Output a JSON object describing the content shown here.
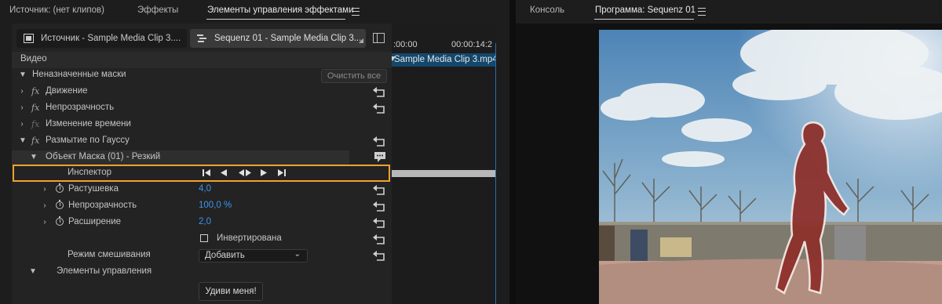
{
  "left_tabs": [
    {
      "label": "Источник: (нет клипов)",
      "active": false
    },
    {
      "label": "Эффекты",
      "active": false
    },
    {
      "label": "Элементы управления эффектами",
      "active": true
    }
  ],
  "right_tabs": [
    {
      "label": "Консоль",
      "active": false
    },
    {
      "label": "Программа: Sequenz 01",
      "active": true
    }
  ],
  "source_tabs": [
    {
      "label": "Источник - Sample Media Clip 3....",
      "icon": "film-icon",
      "active": false
    },
    {
      "label": "Sequenz 01 - Sample Media Clip 3....",
      "icon": "sequence-icon",
      "active": true
    }
  ],
  "timecodes": {
    "start": ":00:00",
    "end": "00:00:14:2"
  },
  "timeline_clip_label": "Sample Media Clip 3.mp4",
  "section_video": "Видео",
  "unassigned_masks": "Неназначенные маски",
  "clear_all_button": "Очистить все",
  "effects": [
    {
      "label": "Движение",
      "fx_active": true
    },
    {
      "label": "Непрозрачность",
      "fx_active": true
    },
    {
      "label": "Изменение времени",
      "fx_active": false
    },
    {
      "label": "Размытие по Гауссу",
      "fx_active": true
    }
  ],
  "mask_object": "Объект Маска (01) - Резкий",
  "inspector_label": "Инспектор",
  "inspector_controls": [
    "step-back-icon",
    "track-backward-icon",
    "track-both-icon",
    "track-forward-icon",
    "step-forward-icon"
  ],
  "params": [
    {
      "label": "Растушевка",
      "value": "4,0"
    },
    {
      "label": "Непрозрачность",
      "value": "100,0 %"
    },
    {
      "label": "Расширение",
      "value": "2,0"
    }
  ],
  "inverted_label": "Инвертирована",
  "inverted_checked": false,
  "blend_mode_label": "Режим смешивания",
  "blend_mode_value": "Добавить",
  "controls_section": "Элементы управления",
  "surprise_button": "Удиви меня!",
  "colors": {
    "accent_blue": "#3a95ef",
    "highlight_orange": "#f2a12c",
    "clip_blue": "#14476b",
    "mask_red": "#8e2f2a"
  }
}
